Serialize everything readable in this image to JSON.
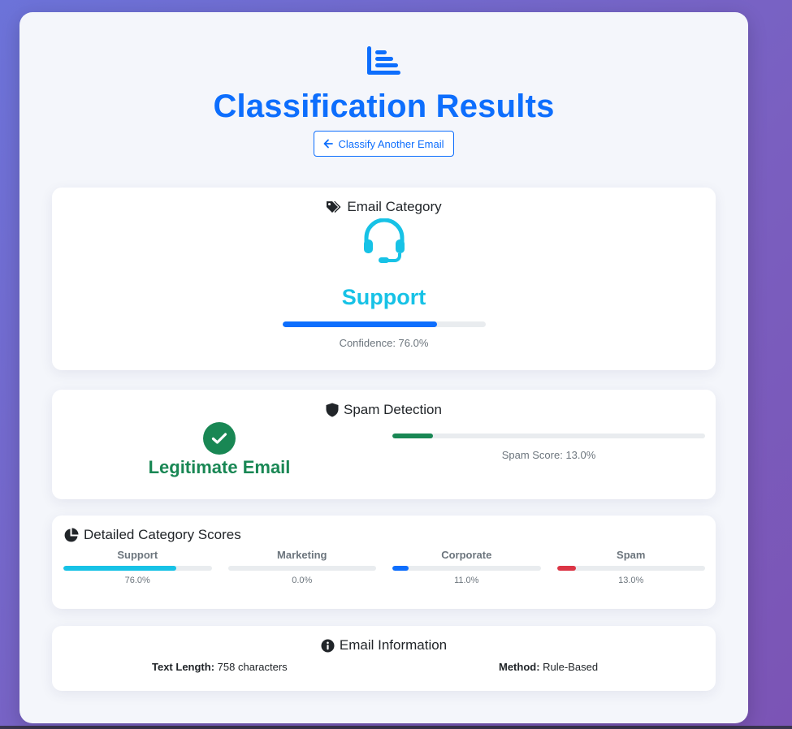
{
  "header": {
    "icon": "chart-bar-icon",
    "title": "Classification Results",
    "back_button_label": "Classify Another Email"
  },
  "category_card": {
    "title": "Email Category",
    "title_icon": "tags-icon",
    "category_icon": "headset-icon",
    "category": "Support",
    "confidence_fraction": 0.76,
    "confidence_text": "Confidence: 76.0%"
  },
  "spam_card": {
    "title": "Spam Detection",
    "title_icon": "shield-icon",
    "status_icon": "check-circle-icon",
    "status": "Legitimate Email",
    "spam_score_fraction": 0.13,
    "spam_score_text": "Spam Score: 13.0%"
  },
  "scores_card": {
    "title": "Detailed Category Scores",
    "title_icon": "pie-chart-icon",
    "items": [
      {
        "label": "Support",
        "value_text": "76.0%",
        "fraction": 0.76,
        "color": "#17c2e6"
      },
      {
        "label": "Marketing",
        "value_text": "0.0%",
        "fraction": 0.0,
        "color": "#6c757d"
      },
      {
        "label": "Corporate",
        "value_text": "11.0%",
        "fraction": 0.11,
        "color": "#0d6efd"
      },
      {
        "label": "Spam",
        "value_text": "13.0%",
        "fraction": 0.13,
        "color": "#dc3545"
      }
    ]
  },
  "info_card": {
    "title": "Email Information",
    "title_icon": "info-circle-icon",
    "text_length_label": "Text Length:",
    "text_length_value": "758 characters",
    "method_label": "Method:",
    "method_value": "Rule-Based"
  },
  "colors": {
    "primary": "#0d6efd",
    "info": "#17c2e6",
    "success": "#198754",
    "danger": "#dc3545"
  }
}
